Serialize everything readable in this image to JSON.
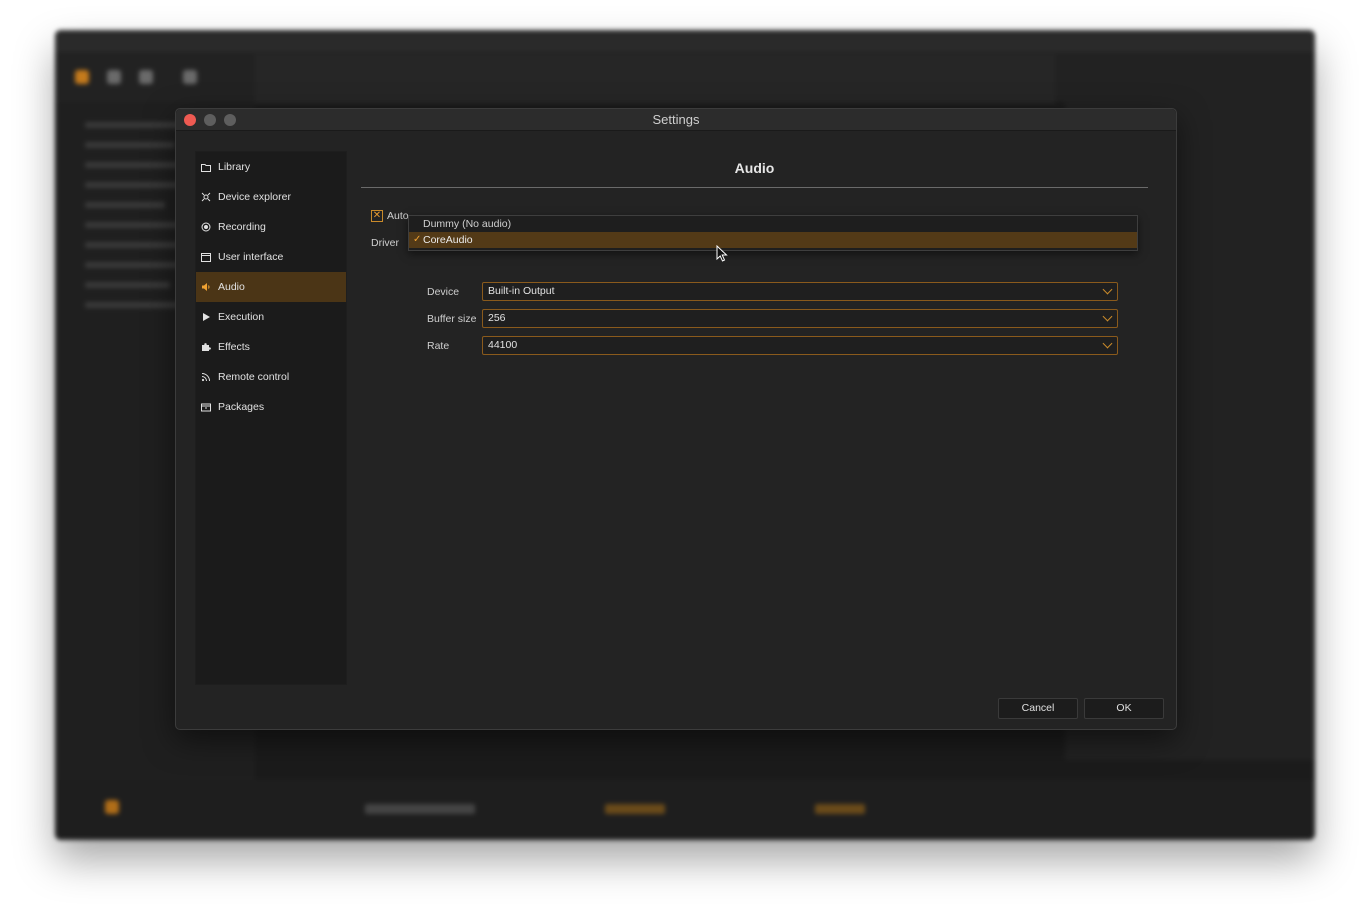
{
  "dialog": {
    "title": "Settings"
  },
  "sidebar": {
    "items": [
      {
        "label": "Library",
        "icon": "folder-icon"
      },
      {
        "label": "Device explorer",
        "icon": "device-explorer-icon"
      },
      {
        "label": "Recording",
        "icon": "record-icon"
      },
      {
        "label": "User interface",
        "icon": "window-icon"
      },
      {
        "label": "Audio",
        "icon": "speaker-icon",
        "active": true
      },
      {
        "label": "Execution",
        "icon": "play-icon"
      },
      {
        "label": "Effects",
        "icon": "puzzle-icon"
      },
      {
        "label": "Remote control",
        "icon": "rss-icon"
      },
      {
        "label": "Packages",
        "icon": "package-icon"
      }
    ]
  },
  "audio": {
    "title": "Audio",
    "auto_stop_label": "Auto",
    "auto_stop_checked": true,
    "driver_label": "Driver",
    "driver_options": [
      "Dummy (No audio)",
      "CoreAudio"
    ],
    "driver_selected": "CoreAudio",
    "device_label": "Device",
    "device_value": "Built-in Output",
    "buffer_label": "Buffer size",
    "buffer_value": "256",
    "rate_label": "Rate",
    "rate_value": "44100"
  },
  "buttons": {
    "cancel": "Cancel",
    "ok": "OK"
  },
  "colors": {
    "accent": "#f0a232",
    "selection": "#4b3516",
    "close": "#ee5a52"
  }
}
